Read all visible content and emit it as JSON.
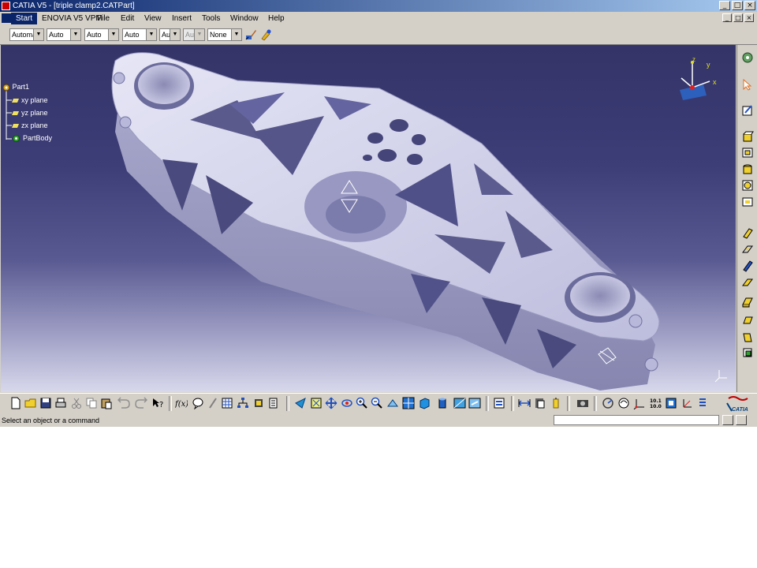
{
  "window": {
    "title": "CATIA V5 - [triple clamp2.CATPart]",
    "min": "_",
    "max": "□",
    "close": "×"
  },
  "menubar": {
    "items": [
      "Start",
      "ENOVIA V5 VPM",
      "File",
      "Edit",
      "View",
      "Insert",
      "Tools",
      "Window",
      "Help"
    ]
  },
  "toolbar_top": {
    "combos": [
      "Automa",
      "Auto",
      "Auto",
      "Auto",
      "Aut",
      "Aut",
      "None"
    ]
  },
  "tree": {
    "root": "Part1",
    "items": [
      "xy plane",
      "yz plane",
      "zx plane",
      "PartBody"
    ]
  },
  "compass": {
    "x": "x",
    "y": "y",
    "z": "z"
  },
  "status": {
    "message": "Select an object or a command",
    "command_value": ""
  },
  "colors": {
    "background_top": "#343468",
    "background_bottom": "#d8d8ec",
    "part": "#c8c8e8",
    "ui": "#d4d0c8"
  },
  "icons": {
    "top": [
      "paintbrush-icon",
      "painter-icon"
    ],
    "bottom": [
      "new-icon",
      "open-icon",
      "save-icon",
      "print-icon",
      "cut-icon",
      "copy-icon",
      "paste-icon",
      "undo-icon",
      "redo-icon",
      "whats-this-icon",
      "formula-icon",
      "knowledge-icon",
      "sketch-icon",
      "table-icon",
      "tree-icon",
      "measure-icon",
      "catalog-icon",
      "fly-icon",
      "fit-all-icon",
      "pan-icon",
      "rotate-icon",
      "zoom-in-icon",
      "zoom-out-icon",
      "normal-view-icon",
      "multi-view-icon",
      "iso-view-icon",
      "shading-icon",
      "hide-show-icon",
      "swap-icon",
      "update-icon",
      "measure-between-icon",
      "measure-item-icon",
      "inertia-icon",
      "photo-icon",
      "rotate-axis-icon",
      "orbit-icon",
      "axis-icon",
      "decimal-icon",
      "scene-icon",
      "axis-system-icon",
      "list-icon"
    ],
    "right": [
      "settings-icon",
      "select-icon",
      "sketcher-icon",
      "pad-icon",
      "pocket-icon",
      "shaft-icon",
      "hole-icon",
      "rib-icon",
      "slot-icon",
      "stiffener-icon",
      "loft-icon",
      "fillet-icon",
      "chamfer-icon",
      "draft-icon",
      "shell-icon",
      "boolean-icon"
    ]
  }
}
